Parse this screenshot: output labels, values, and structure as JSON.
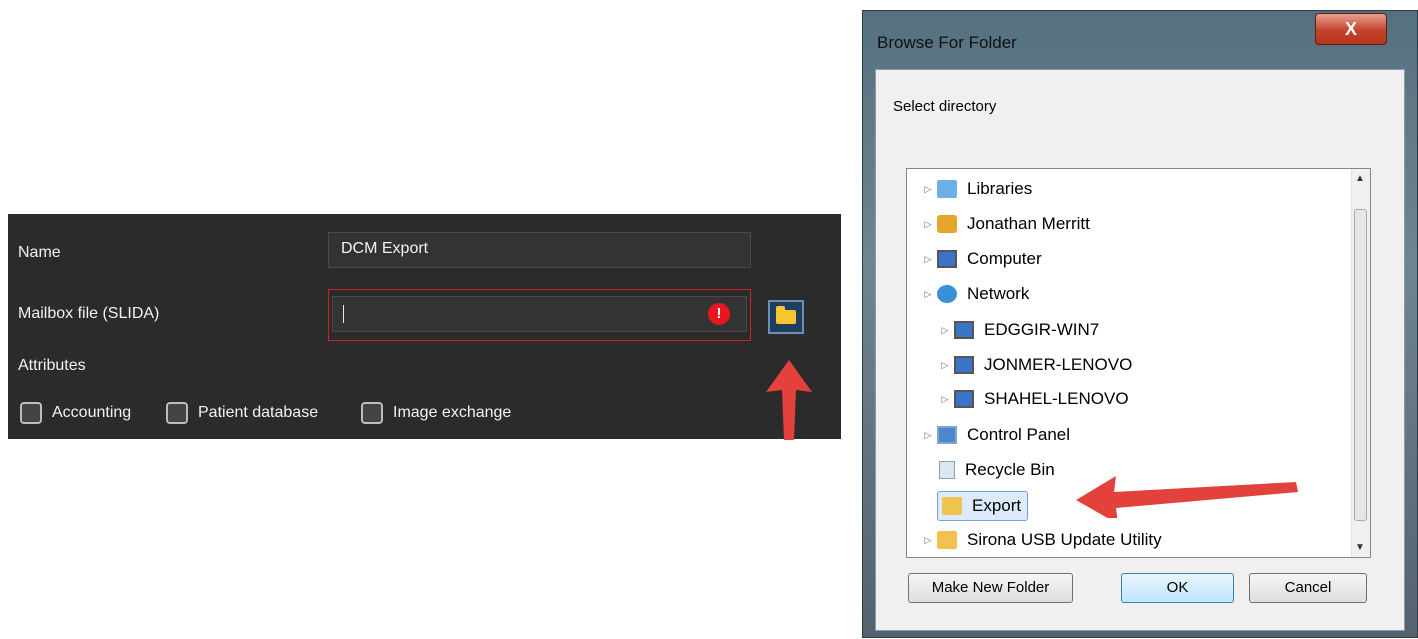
{
  "settings": {
    "name_label": "Name",
    "name_value": "DCM Export",
    "mailbox_label": "Mailbox file (SLIDA)",
    "mailbox_value": "",
    "error_glyph": "!",
    "attributes_label": "Attributes",
    "checkboxes": [
      {
        "label": "Accounting",
        "checked": false
      },
      {
        "label": "Patient database",
        "checked": false
      },
      {
        "label": "Image exchange",
        "checked": false
      }
    ]
  },
  "dialog": {
    "title": "Browse For Folder",
    "close_glyph": "X",
    "prompt": "Select directory",
    "tree": [
      {
        "label": "Libraries",
        "icon": "libraries-icon",
        "expandable": true
      },
      {
        "label": "Jonathan Merritt",
        "icon": "user-folder-icon",
        "expandable": true
      },
      {
        "label": "Computer",
        "icon": "computer-icon",
        "expandable": true
      },
      {
        "label": "Network",
        "icon": "network-icon",
        "expandable": true
      },
      {
        "label": "EDGGIR-WIN7",
        "icon": "computer-icon",
        "expandable": true
      },
      {
        "label": "JONMER-LENOVO",
        "icon": "computer-icon",
        "expandable": true
      },
      {
        "label": "SHAHEL-LENOVO",
        "icon": "computer-icon",
        "expandable": true
      },
      {
        "label": "Control Panel",
        "icon": "control-panel-icon",
        "expandable": true
      },
      {
        "label": "Recycle Bin",
        "icon": "recycle-bin-icon",
        "expandable": false
      },
      {
        "label": "Export",
        "icon": "folder-icon",
        "expandable": false,
        "selected": true
      },
      {
        "label": "Sirona USB Update Utility",
        "icon": "folder-icon",
        "expandable": true
      }
    ],
    "buttons": {
      "make_new_folder": "Make New Folder",
      "ok": "OK",
      "cancel": "Cancel"
    }
  },
  "colors": {
    "panel_bg": "#2b2b2b",
    "error_red": "#e8171f",
    "arrow_red": "#e3423c",
    "selection_bg": "#dceafc"
  }
}
